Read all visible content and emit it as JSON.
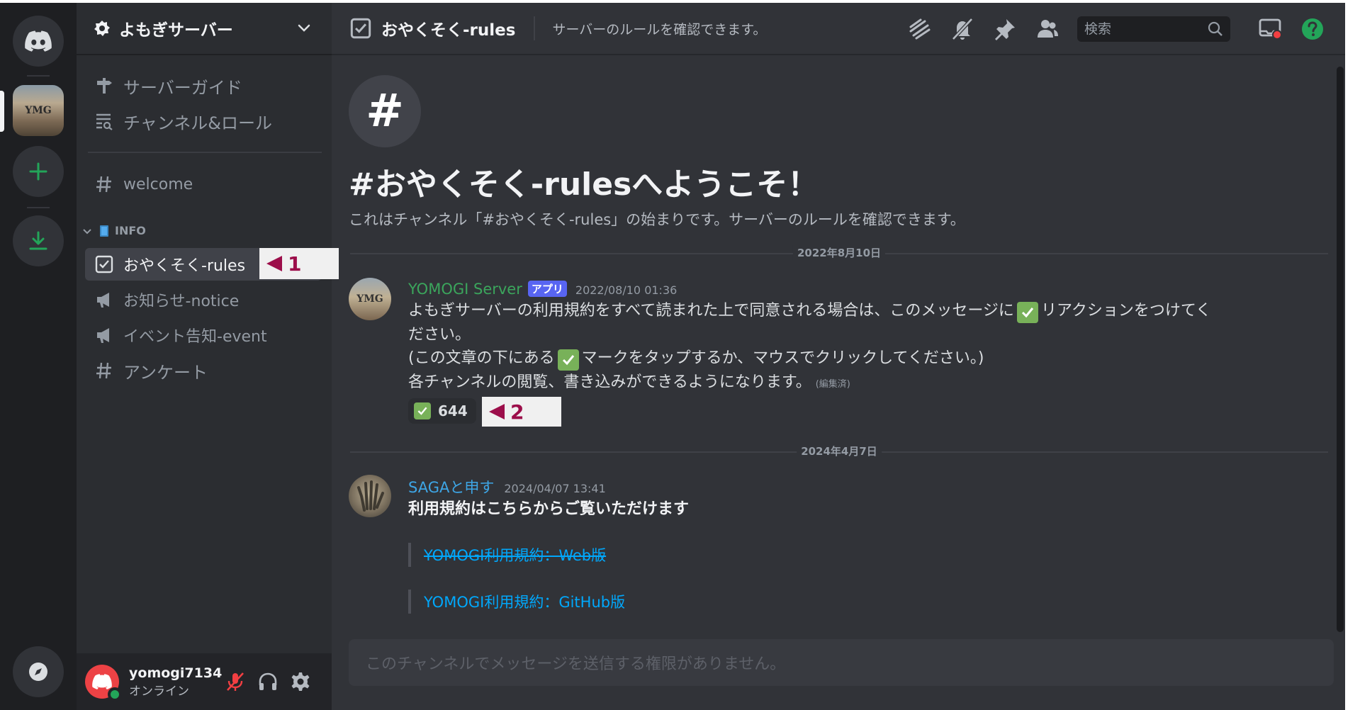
{
  "server": {
    "name": "よもぎサーバー",
    "thumb_text": "YMG"
  },
  "sidebar": {
    "top_items": [
      {
        "label": "サーバーガイド"
      },
      {
        "label": "チャンネル&ロール"
      }
    ],
    "welcome": {
      "label": "welcome"
    },
    "category": "INFO",
    "items": [
      {
        "label": "おやくそく-rules"
      },
      {
        "label": "お知らせ-notice"
      },
      {
        "label": "イベント告知-event"
      },
      {
        "label": "アンケート"
      }
    ],
    "annotation": "1"
  },
  "user": {
    "name": "yomogi7134",
    "status": "オンライン"
  },
  "header": {
    "channel": "おやくそく-rules",
    "topic": "サーバーのルールを確認できます。",
    "search_placeholder": "検索"
  },
  "welcome": {
    "icon": "#",
    "title": "#おやくそく-rulesへようこそ！",
    "subtitle": "これはチャンネル「#おやくそく-rules」の始まりです。サーバーのルールを確認できます。"
  },
  "messages": {
    "date1": "2022年8月10日",
    "m1": {
      "avatar_text": "YMG",
      "author": "YOMOGI Server",
      "badge": "アプリ",
      "time": "2022/08/10 01:36",
      "line1a": "よもぎサーバーの利用規約をすべて読まれた上で同意される場合は、このメッセージに",
      "line1b": "リアクションをつけてく",
      "line2": "ださい。",
      "line3a": "(この文章の下にある",
      "line3b": "マークをタップするか、マウスでクリックしてください。)",
      "line4": "各チャンネルの閲覧、書き込みができるようになります。",
      "edited": "(編集済)",
      "reaction_count": "644",
      "annotation": "2"
    },
    "date2": "2024年4月7日",
    "m2": {
      "author": "SAGAと申す",
      "time": "2024/04/07 13:41",
      "bold": "利用規約はこちらからご覧いただけます",
      "link1": "YOMOGI利用規約：Web版",
      "link2": "YOMOGI利用規約：GitHub版"
    }
  },
  "composer": {
    "placeholder": "このチャンネルでメッセージを送信する権限がありません。"
  },
  "colors": {
    "accent": "#5865f2",
    "green": "#23a559",
    "link": "#00a8fc",
    "annotation": "#9c0e4a"
  }
}
